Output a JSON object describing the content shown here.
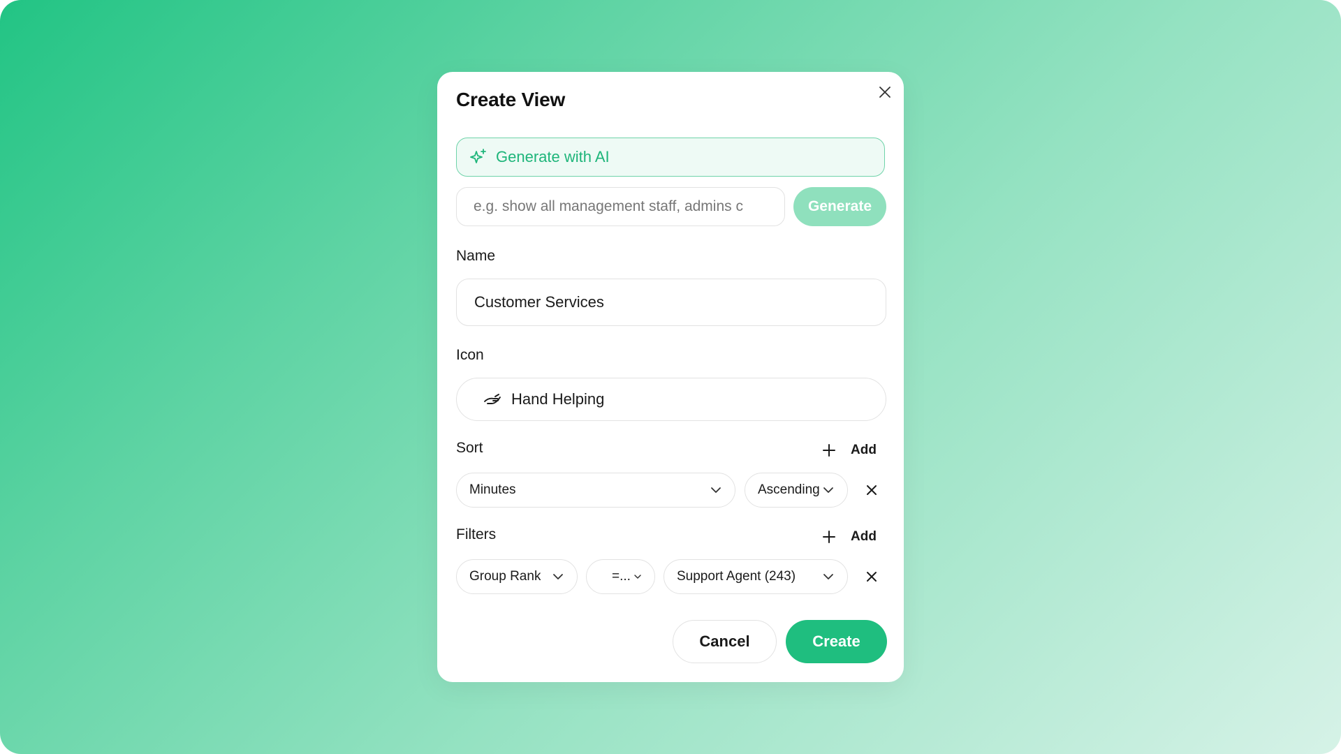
{
  "dialog": {
    "title": "Create View",
    "close_icon": "close-icon"
  },
  "ai": {
    "label": "Generate with AI",
    "icon": "sparkle-icon",
    "prompt_placeholder": "e.g. show all management staff, admins c",
    "prompt_value": "",
    "generate_label": "Generate"
  },
  "name": {
    "label": "Name",
    "value": "Customer Services"
  },
  "icon_field": {
    "label": "Icon",
    "value": "Hand Helping",
    "icon": "hand-helping-icon"
  },
  "sort": {
    "label": "Sort",
    "add_label": "Add",
    "field": "Minutes",
    "direction": "Ascending"
  },
  "filters": {
    "label": "Filters",
    "add_label": "Add",
    "field": "Group Rank",
    "operator": "=...",
    "value": "Support Agent (243)"
  },
  "actions": {
    "cancel_label": "Cancel",
    "create_label": "Create"
  },
  "colors": {
    "accent": "#1fbe7f",
    "accent_light": "#8fe0bd",
    "ai_bar_bg": "#eefaf5"
  }
}
